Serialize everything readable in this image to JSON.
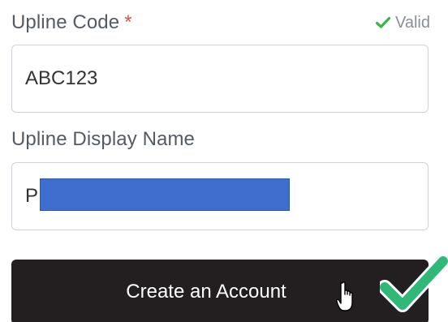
{
  "upline_code": {
    "label": "Upline Code",
    "required_mark": "*",
    "status": "Valid",
    "value": "ABC123"
  },
  "upline_display_name": {
    "label": "Upline Display Name",
    "value_visible": "P"
  },
  "submit": {
    "label": "Create an Account"
  },
  "colors": {
    "valid_check": "#3ab54a",
    "required": "#d9534f",
    "button_bg": "#231f20",
    "redaction": "#3f6fce",
    "big_check": "#2fb878"
  }
}
